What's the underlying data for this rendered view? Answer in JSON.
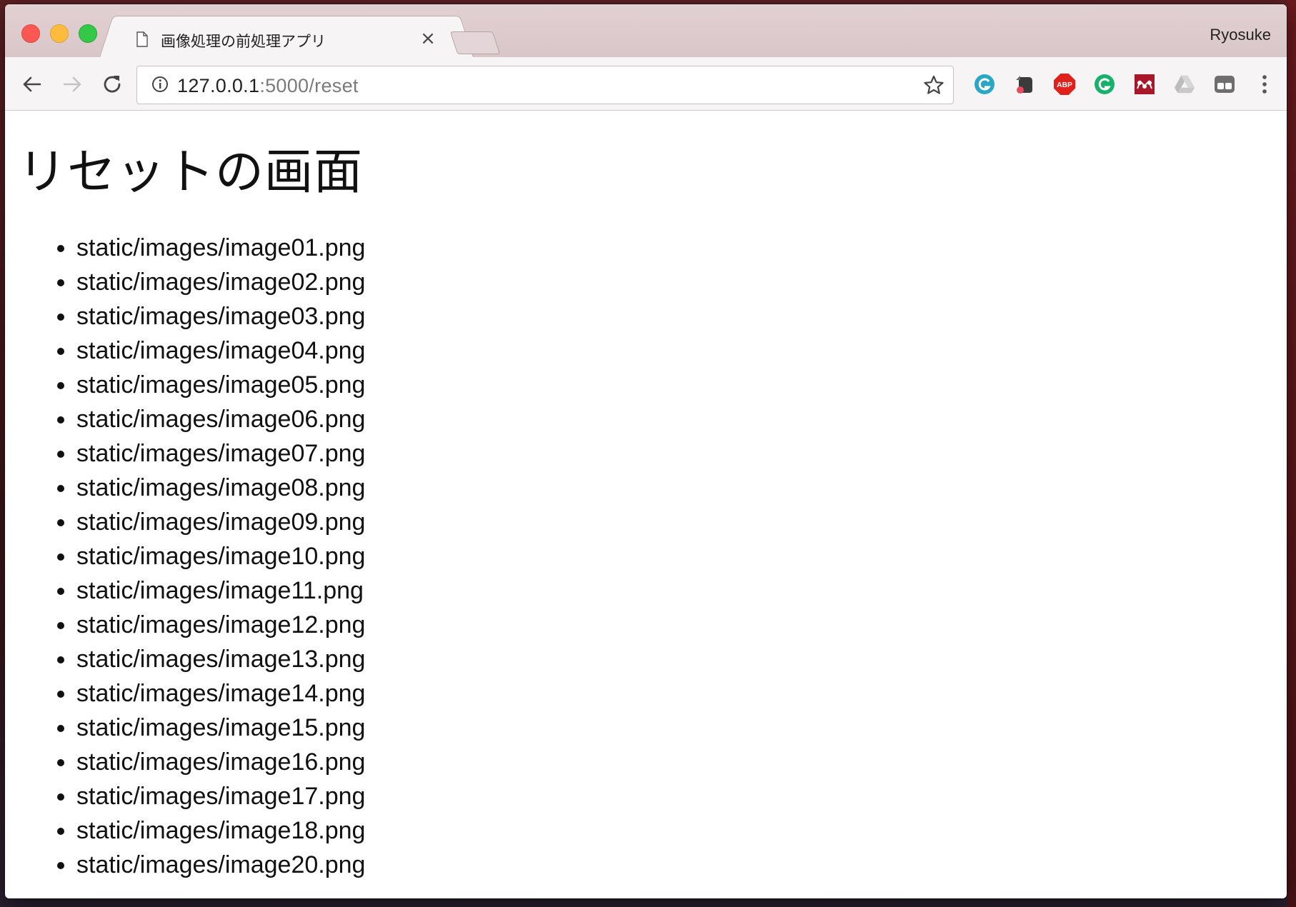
{
  "browser": {
    "tab": {
      "title": "画像処理の前処理アプリ",
      "close_glyph": "×"
    },
    "profile_name": "Ryosuke",
    "address_bar": {
      "url_host": "127.0.0.1",
      "url_rest": ":5000/reset"
    },
    "extensions": [
      "grammarly-icon",
      "evernote-icon",
      "adblock-plus-icon",
      "grammarly-green-icon",
      "mendeley-icon",
      "google-drive-icon",
      "incognito-extension-icon"
    ],
    "colors": {
      "close": "#fc5753",
      "minimize": "#fdbc40",
      "zoom": "#34c748"
    }
  },
  "page": {
    "heading": "リセットの画面",
    "files": [
      "static/images/image01.png",
      "static/images/image02.png",
      "static/images/image03.png",
      "static/images/image04.png",
      "static/images/image05.png",
      "static/images/image06.png",
      "static/images/image07.png",
      "static/images/image08.png",
      "static/images/image09.png",
      "static/images/image10.png",
      "static/images/image11.png",
      "static/images/image12.png",
      "static/images/image13.png",
      "static/images/image14.png",
      "static/images/image15.png",
      "static/images/image16.png",
      "static/images/image17.png",
      "static/images/image18.png",
      "static/images/image20.png"
    ]
  }
}
